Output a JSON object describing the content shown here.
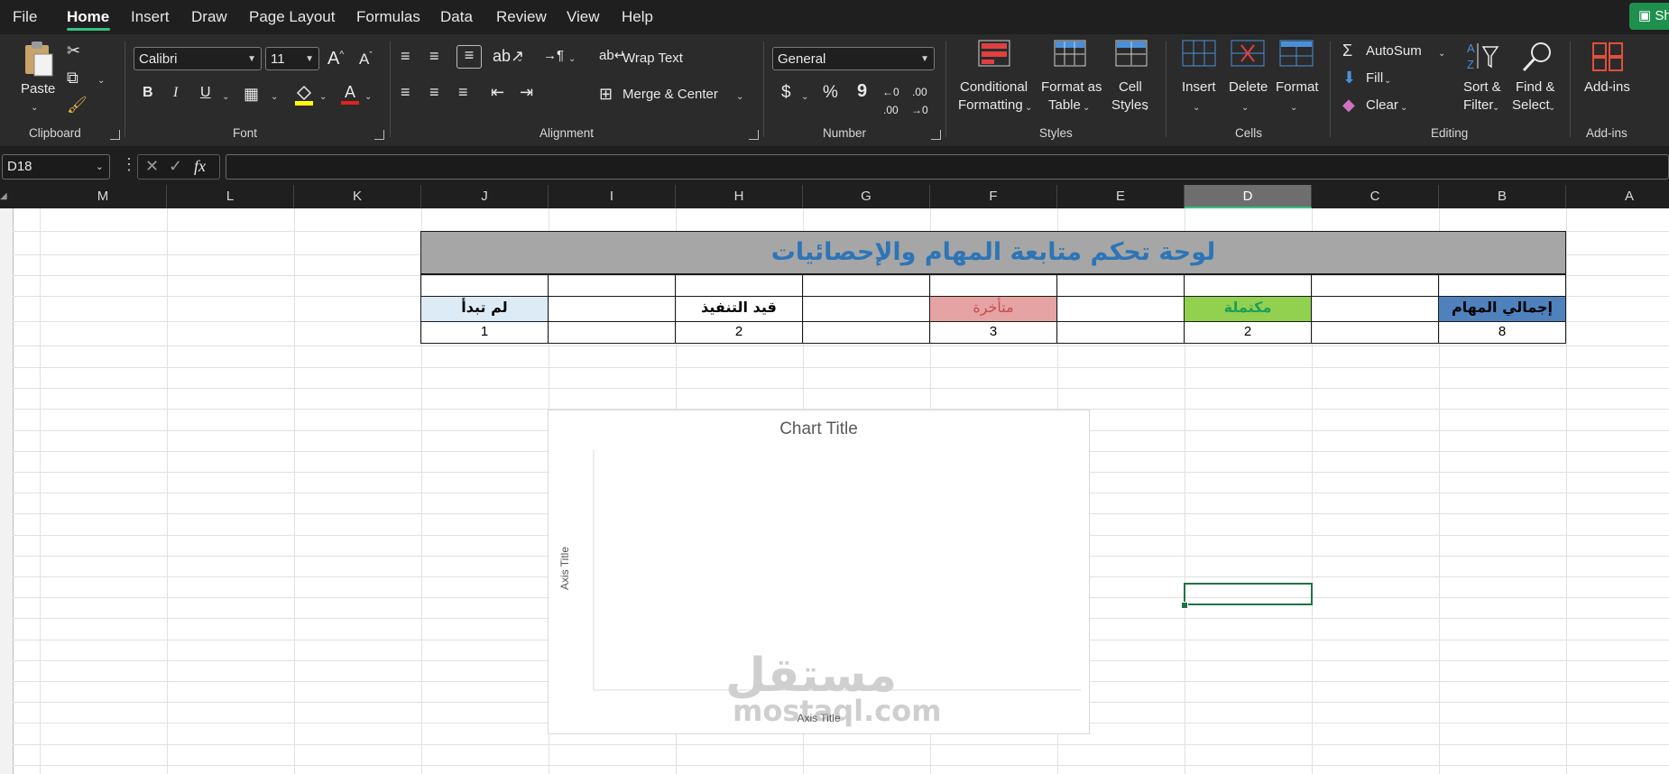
{
  "menu": {
    "items": [
      "File",
      "Home",
      "Insert",
      "Draw",
      "Page Layout",
      "Formulas",
      "Data",
      "Review",
      "View",
      "Help"
    ],
    "active": "Home",
    "share_label": "Sh"
  },
  "ribbon": {
    "clipboard": {
      "paste": "Paste",
      "label": "Clipboard"
    },
    "font": {
      "name": "Calibri",
      "size": "11",
      "label": "Font",
      "bold": "B",
      "italic": "I",
      "underline": "U",
      "grow": "A",
      "shrink": "A"
    },
    "alignment": {
      "wrap": "Wrap Text",
      "merge": "Merge & Center",
      "label": "Alignment"
    },
    "number": {
      "format": "General",
      "currency": "$",
      "percent": "%",
      "comma": "9",
      "label": "Number"
    },
    "styles": {
      "conditional_1": "Conditional",
      "conditional_2": "Formatting",
      "format_table_1": "Format as",
      "format_table_2": "Table",
      "cell_styles_1": "Cell",
      "cell_styles_2": "Styles",
      "label": "Styles"
    },
    "cells": {
      "insert": "Insert",
      "delete": "Delete",
      "format": "Format",
      "label": "Cells"
    },
    "editing": {
      "autosum": "AutoSum",
      "fill": "Fill",
      "clear": "Clear",
      "sort_1": "Sort &",
      "sort_2": "Filter",
      "find_1": "Find &",
      "find_2": "Select",
      "label": "Editing"
    },
    "addins": {
      "button": "Add-ins",
      "label": "Add-ins"
    }
  },
  "formula_bar": {
    "name_box": "D18",
    "fx": "fx",
    "value": ""
  },
  "columns": [
    "M",
    "L",
    "K",
    "J",
    "I",
    "H",
    "G",
    "F",
    "E",
    "D",
    "C",
    "B",
    "A"
  ],
  "selected_column": "D",
  "dashboard": {
    "title": "لوحة تحكم متابعة المهام والإحصائيات",
    "headers": {
      "total": "إجمالي المهام",
      "completed": "مكتملة",
      "overdue": "متأخرة",
      "in_progress": "قيد التنفيذ",
      "not_started": "لم تبدأ"
    },
    "values": {
      "total": "8",
      "completed": "2",
      "overdue": "3",
      "in_progress": "2",
      "not_started": "1"
    },
    "colors": {
      "title_bg": "#a6a6a6",
      "title_text": "#2e75b6",
      "total_bg": "#4f81bd",
      "completed_bg": "#92d050",
      "completed_text": "#1e9e5a",
      "overdue_bg": "#e6a3a3",
      "overdue_text": "#c0504d",
      "not_started_bg": "#ddebf7"
    }
  },
  "chart": {
    "title": "Chart Title",
    "x_axis_title": "Axis Title",
    "y_axis_title": "Axis Title"
  },
  "chart_data": {
    "type": "bar",
    "title": "Chart Title",
    "xlabel": "Axis Title",
    "ylabel": "Axis Title",
    "series": []
  },
  "watermark": {
    "arabic": "مستقل",
    "latin": "mostaql.com"
  }
}
